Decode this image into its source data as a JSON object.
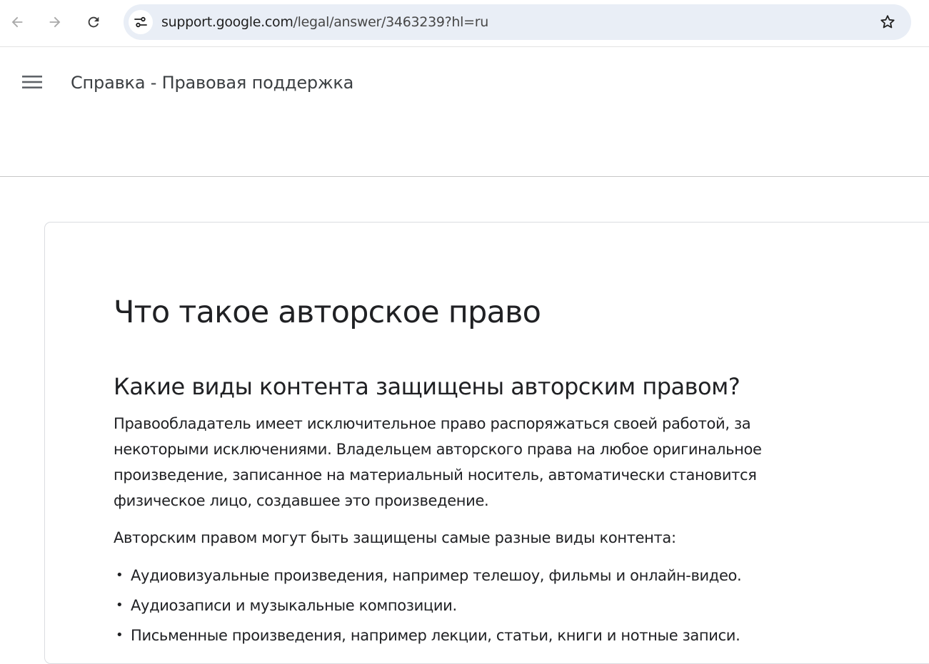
{
  "browser": {
    "url_host": "support.google.com",
    "url_path": "/legal/answer/3463239?hl=ru",
    "icons": {
      "back": "arrow-left-icon",
      "forward": "arrow-right-icon",
      "reload": "reload-icon",
      "site_info": "site-info-icon",
      "bookmark": "star-icon"
    }
  },
  "header": {
    "menu_icon": "hamburger-menu-icon",
    "title": "Справка - Правовая поддержка"
  },
  "article": {
    "title": "Что такое авторское право",
    "section_heading": "Какие виды контента защищены авторским правом?",
    "paragraph1": "Правообладатель имеет исключительное право распоряжаться своей работой, за некоторыми исключениями. Владельцем авторского права на любое оригинальное произведение, записанное на материальный носитель, автоматически становится физическое лицо, создавшее это произведение.",
    "paragraph2": "Авторским правом могут быть защищены самые разные виды контента:",
    "bullet": "•",
    "list": [
      "Аудиовизуальные произведения, например телешоу, фильмы и онлайн-видео.",
      "Аудиозаписи и музыкальные композиции.",
      "Письменные произведения, например лекции, статьи, книги и нотные записи."
    ]
  },
  "colors": {
    "omnibox_bg": "#e9eef6",
    "text": "#202124",
    "border": "#dadce0"
  }
}
